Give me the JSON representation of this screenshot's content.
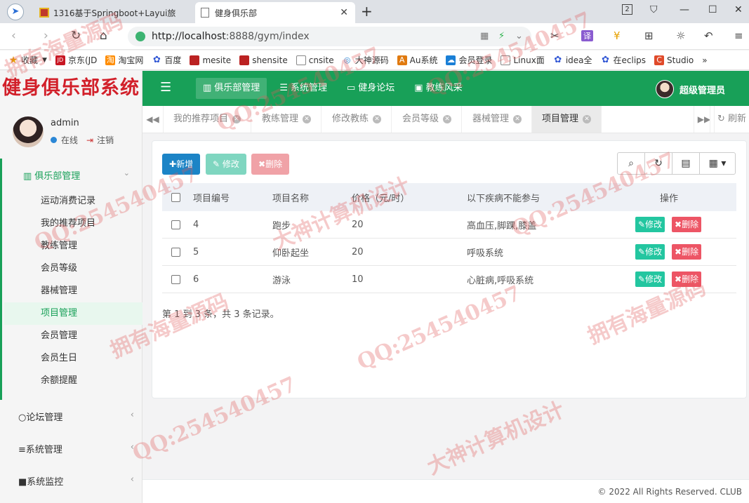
{
  "browser": {
    "tab_inactive_title": "1316基于Springboot+Layui旅",
    "tab_active_title": "健身俱乐部",
    "tab_count_badge": "2",
    "url_host": "http://localhost",
    "url_rest": ":8888/gym/index",
    "translate_label": "译",
    "bookmarks": [
      "收藏",
      "京东(JD",
      "淘宝网",
      "百度",
      "mesite",
      "shensite",
      "cnsite",
      "大神源码",
      "Au系统",
      "会员登录",
      "Linux面",
      "idea全",
      "在eclips",
      "Studio"
    ],
    "bookmarks_more": "»"
  },
  "app": {
    "logo": "健身俱乐部系统",
    "nav": [
      {
        "label": "俱乐部管理",
        "icon": "bar-chart-icon"
      },
      {
        "label": "系统管理",
        "icon": "list-icon"
      },
      {
        "label": "健身论坛",
        "icon": "forum-icon"
      },
      {
        "label": "教练风采",
        "icon": "image-icon"
      }
    ],
    "user_name": "超级管理员"
  },
  "sidebar": {
    "profile_name": "admin",
    "status": "在线",
    "logout": "注销",
    "group_title": "俱乐部管理",
    "items": [
      "运动消费记录",
      "我的推荐项目",
      "教练管理",
      "会员等级",
      "器械管理",
      "项目管理",
      "会员管理",
      "会员生日",
      "余额提醒"
    ],
    "other_groups": [
      "论坛管理",
      "系统管理",
      "系统监控"
    ]
  },
  "content_tabs": [
    "我的推荐项目",
    "教练管理",
    "修改教练",
    "会员等级",
    "器械管理",
    "项目管理"
  ],
  "refresh_label": "刷新",
  "toolbar": {
    "add": "新增",
    "edit": "修改",
    "delete": "删除"
  },
  "table": {
    "headers": [
      "项目编号",
      "项目名称",
      "价格（元/时）",
      "以下疾病不能参与",
      "操作"
    ],
    "rows": [
      {
        "id": "4",
        "name": "跑步",
        "price": "20",
        "disease": "高血压,脚踝,膝盖"
      },
      {
        "id": "5",
        "name": "仰卧起坐",
        "price": "20",
        "disease": "呼吸系统"
      },
      {
        "id": "6",
        "name": "游泳",
        "price": "10",
        "disease": "心脏病,呼吸系统"
      }
    ],
    "row_edit": "修改",
    "row_delete": "删除"
  },
  "pagination": "第 1 到 3 条，共 3 条记录。",
  "footer": "© 2022 All Rights Reserved. CLUB",
  "watermarks": [
    "QQ:254540457",
    "拥有海量源码",
    "大神计算机设计"
  ],
  "colors": {
    "primary_green": "#18a058",
    "logo_red": "#d2202a",
    "add_blue": "#1c84c6",
    "edit_teal": "#23c6a0",
    "delete_red": "#ed5565"
  }
}
